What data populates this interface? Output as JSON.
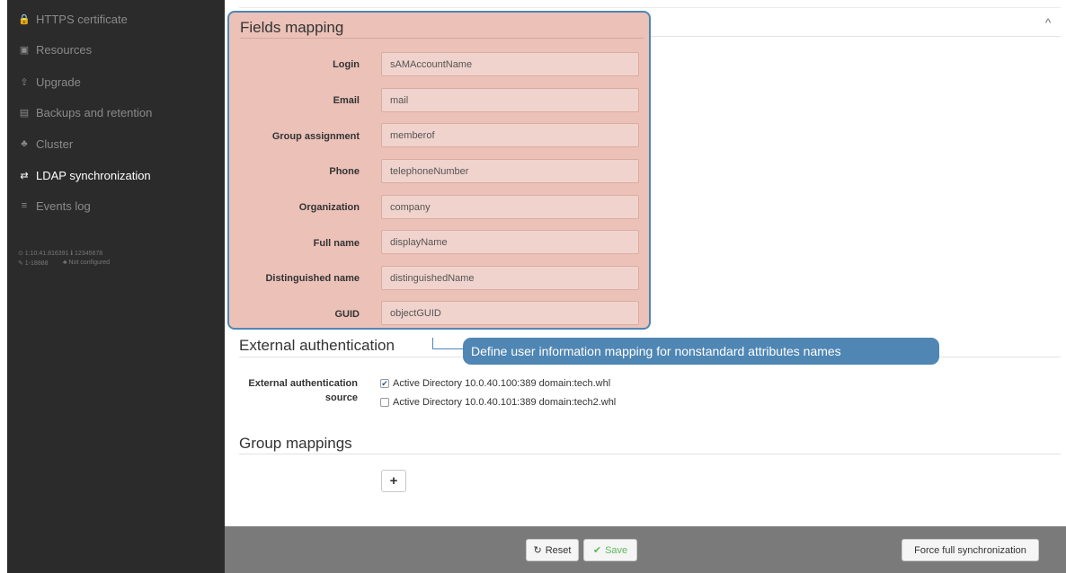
{
  "sidebar": {
    "items": [
      {
        "icon": "lock-icon",
        "glyph": "🔒",
        "label": "HTTPS certificate"
      },
      {
        "icon": "image-icon",
        "glyph": "▣",
        "label": "Resources"
      },
      {
        "icon": "upload-icon",
        "glyph": "⇪",
        "label": "Upgrade"
      },
      {
        "icon": "database-icon",
        "glyph": "▤",
        "label": "Backups and retention"
      },
      {
        "icon": "sitemap-icon",
        "glyph": "♣",
        "label": "Cluster"
      },
      {
        "icon": "exchange-icon",
        "glyph": "⇄",
        "label": "LDAP synchronization"
      },
      {
        "icon": "list-icon",
        "glyph": "≡",
        "label": "Events log"
      }
    ],
    "meta_line1": "⊙ 1:10:41.816391 ℹ 12345678",
    "meta_line2a": "✎ 1-18888",
    "meta_line2b": "♣ Not configured"
  },
  "fields_mapping": {
    "title": "Fields mapping",
    "rows": [
      {
        "label": "Login",
        "value": "sAMAccountName"
      },
      {
        "label": "Email",
        "value": "mail"
      },
      {
        "label": "Group assignment",
        "value": "memberof"
      },
      {
        "label": "Phone",
        "value": "telephoneNumber"
      },
      {
        "label": "Organization",
        "value": "company"
      },
      {
        "label": "Full name",
        "value": "displayName"
      },
      {
        "label": "Distinguished name",
        "value": "distinguishedName"
      },
      {
        "label": "GUID",
        "value": "objectGUID"
      }
    ]
  },
  "collapse_glyph": "^",
  "callout": "Define user information mapping for nonstandard attributes names",
  "external_auth": {
    "title": "External authentication",
    "label_line1": "External authentication",
    "label_line2": "source",
    "options": [
      {
        "label": "Active Directory 10.0.40.100:389 domain:tech.whl",
        "checked": true,
        "mark": "✔"
      },
      {
        "label": "Active Directory 10.0.40.101:389 domain:tech2.whl",
        "checked": false,
        "mark": ""
      }
    ]
  },
  "group_mappings": {
    "title": "Group mappings",
    "add_glyph": "+"
  },
  "footer": {
    "reset_glyph": "↻",
    "reset_label": "Reset",
    "save_glyph": "✔",
    "save_label": "Save",
    "force_label": "Force full synchronization"
  },
  "colors": {
    "sidebar_bg": "#2b2b2b",
    "highlight_fill": "#ebc1b8",
    "highlight_border": "#4f86b3",
    "callout_bg": "#4f86b3",
    "footer_bg": "#7a7a7a",
    "save_green": "#5cb85c"
  }
}
